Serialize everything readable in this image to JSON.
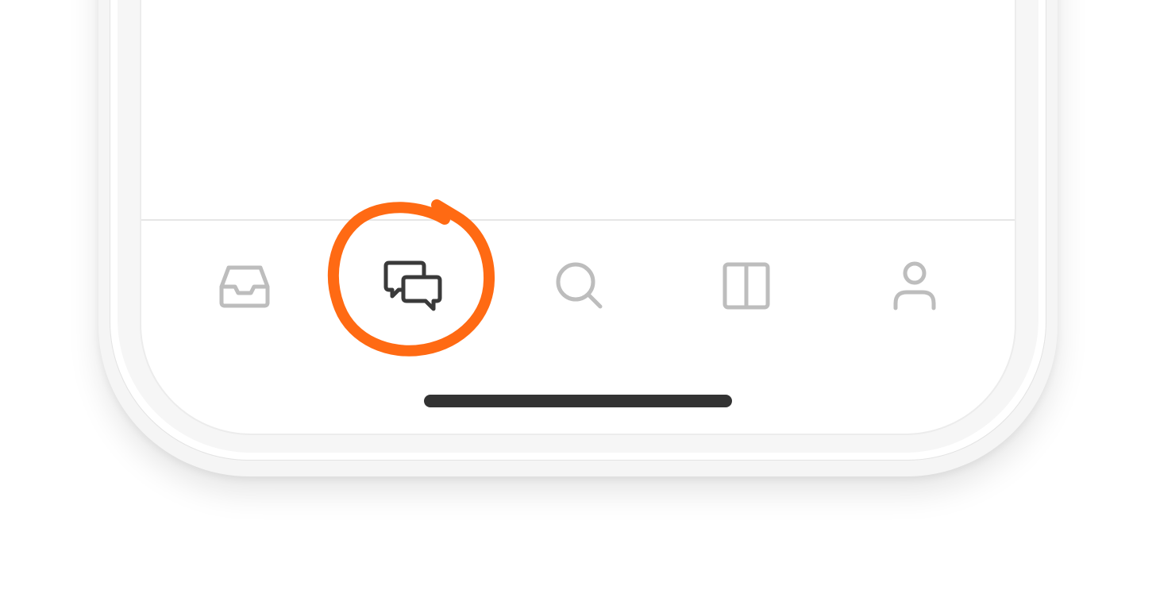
{
  "tab_bar": {
    "tabs": [
      {
        "id": "inbox",
        "icon": "inbox-icon",
        "active": false
      },
      {
        "id": "chat",
        "icon": "chat-bubbles-icon",
        "active": true
      },
      {
        "id": "search",
        "icon": "search-icon",
        "active": false
      },
      {
        "id": "reader",
        "icon": "columns-icon",
        "active": false
      },
      {
        "id": "profile",
        "icon": "person-icon",
        "active": false
      }
    ]
  },
  "colors": {
    "icon_inactive": "#bdbdbd",
    "icon_active": "#3a3a3a",
    "highlight": "#ff6a13",
    "home_indicator": "#333333",
    "divider": "#e6e6e6"
  }
}
